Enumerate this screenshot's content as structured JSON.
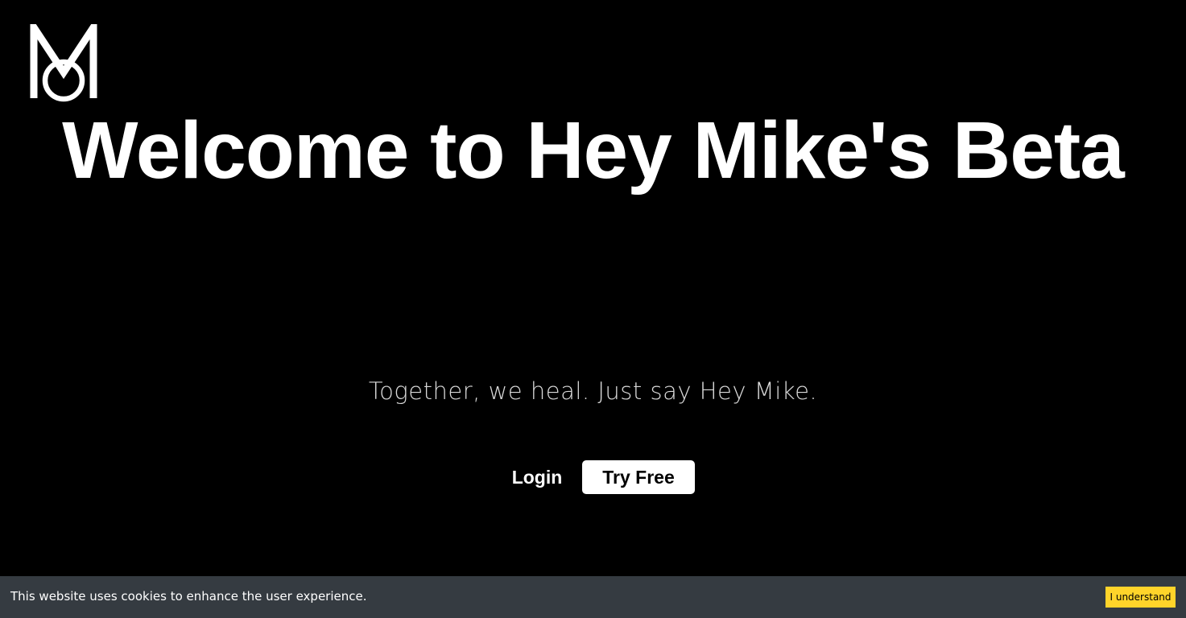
{
  "header": {
    "logo_icon": "hey-mike-monogram-icon"
  },
  "hero": {
    "title": "Welcome to Hey Mike's Beta",
    "tagline": "Together, we heal. Just say Hey Mike."
  },
  "actions": {
    "login_label": "Login",
    "try_free_label": "Try Free"
  },
  "cookie_banner": {
    "message": "This website uses cookies to enhance the user experience.",
    "accept_label": "I understand"
  },
  "colors": {
    "page_background": "#000000",
    "text_primary": "#ffffff",
    "cookie_bar_background": "#353b41",
    "cookie_button_background": "#ffd42a"
  }
}
